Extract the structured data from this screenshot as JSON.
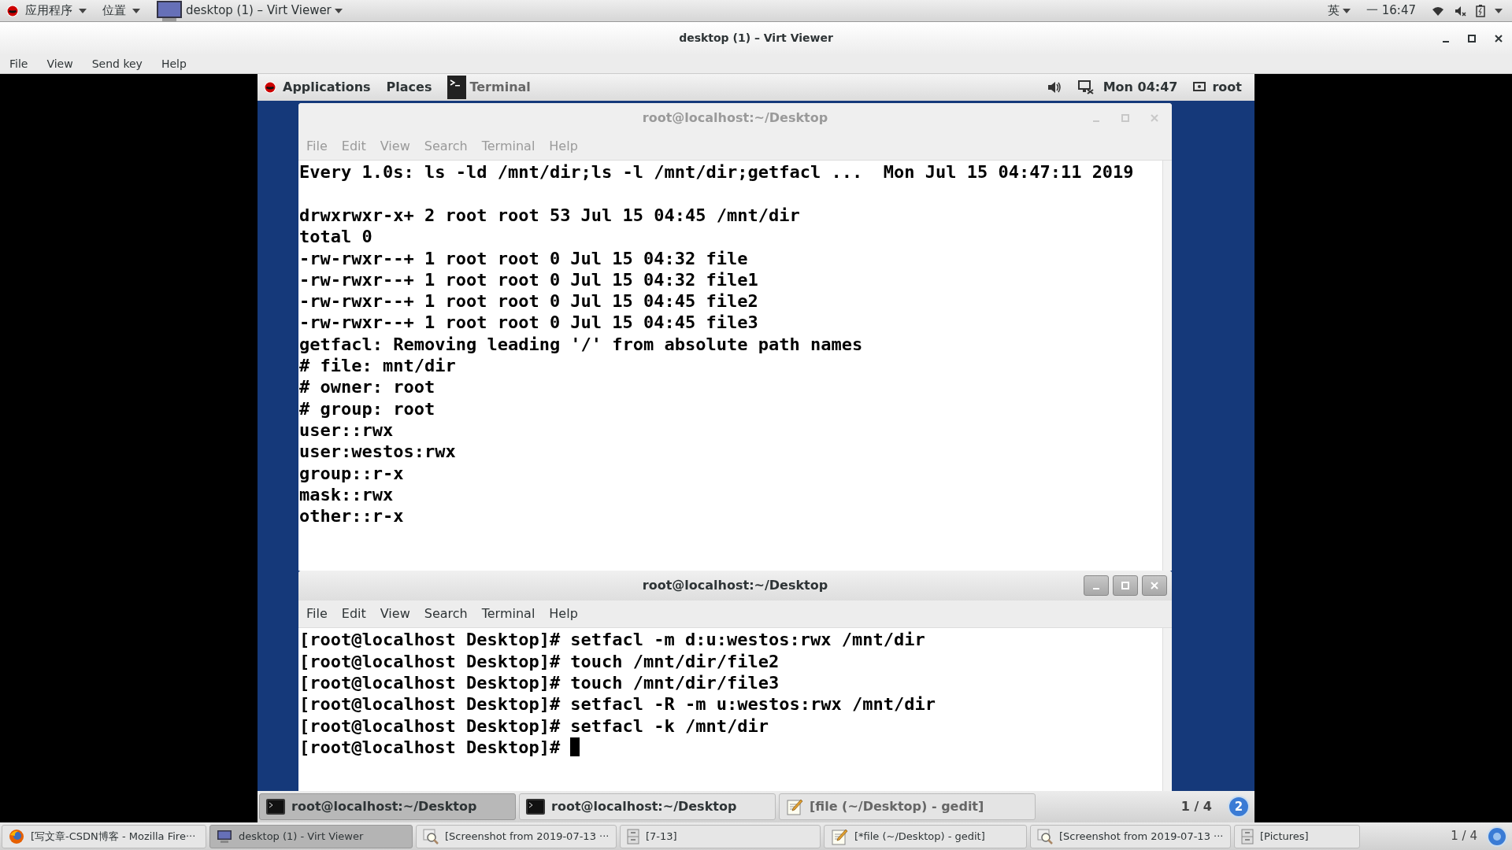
{
  "host_top_bar": {
    "app_menu": "应用程序",
    "places": "位置",
    "window_menu": "desktop (1) – Virt Viewer",
    "input_method": "英",
    "clock": "一 16:47"
  },
  "viewer_window": {
    "title": "desktop (1) – Virt Viewer",
    "menu": [
      "File",
      "View",
      "Send key",
      "Help"
    ]
  },
  "guest_top_bar": {
    "applications": "Applications",
    "places": "Places",
    "active_app": "Terminal",
    "clock": "Mon 04:47",
    "user": "root"
  },
  "terminals": [
    {
      "title": "root@localhost:~/Desktop",
      "focused": false,
      "menu": [
        "File",
        "Edit",
        "View",
        "Search",
        "Terminal",
        "Help"
      ],
      "header": "Every 1.0s: ls -ld /mnt/dir;ls -l /mnt/dir;getfacl ...  Mon Jul 15 04:47:11 2019",
      "lines": [
        "drwxrwxr-x+ 2 root root 53 Jul 15 04:45 /mnt/dir",
        "total 0",
        "-rw-rwxr--+ 1 root root 0 Jul 15 04:32 file",
        "-rw-rwxr--+ 1 root root 0 Jul 15 04:32 file1",
        "-rw-rwxr--+ 1 root root 0 Jul 15 04:45 file2",
        "-rw-rwxr--+ 1 root root 0 Jul 15 04:45 file3",
        "getfacl: Removing leading '/' from absolute path names",
        "# file: mnt/dir",
        "# owner: root",
        "# group: root",
        "user::rwx",
        "user:westos:rwx",
        "group::r-x",
        "mask::rwx",
        "other::r-x"
      ],
      "cursor": false
    },
    {
      "title": "root@localhost:~/Desktop",
      "focused": true,
      "menu": [
        "File",
        "Edit",
        "View",
        "Search",
        "Terminal",
        "Help"
      ],
      "lines": [
        "[root@localhost Desktop]# setfacl -m d:u:westos:rwx /mnt/dir",
        "[root@localhost Desktop]# touch /mnt/dir/file2",
        "[root@localhost Desktop]# touch /mnt/dir/file3",
        "[root@localhost Desktop]# setfacl -R -m u:westos:rwx /mnt/dir",
        "[root@localhost Desktop]# setfacl -k /mnt/dir",
        "[root@localhost Desktop]# "
      ],
      "cursor": true
    }
  ],
  "guest_taskbar": {
    "items": [
      {
        "kind": "terminal",
        "label": "root@localhost:~/Desktop",
        "selected": true
      },
      {
        "kind": "terminal",
        "label": "root@localhost:~/Desktop",
        "selected": false
      },
      {
        "kind": "gedit",
        "label": "[file (~/Desktop) - gedit]",
        "selected": false
      }
    ],
    "workspace": "1 / 4",
    "workspace_badge": "2"
  },
  "host_taskbar": {
    "items": [
      {
        "kind": "firefox",
        "label": "[写文章-CSDN博客 - Mozilla Fire···",
        "selected": false
      },
      {
        "kind": "viewer",
        "label": "desktop (1) - Virt Viewer",
        "selected": true
      },
      {
        "kind": "screenshot",
        "label": "[Screenshot from 2019-07-13 ···",
        "selected": false
      },
      {
        "kind": "files",
        "label": "[7-13]",
        "selected": false
      },
      {
        "kind": "gedit",
        "label": "[*file (~/Desktop) - gedit]",
        "selected": false
      },
      {
        "kind": "screenshot",
        "label": "[Screenshot from 2019-07-13 ···",
        "selected": false
      },
      {
        "kind": "files",
        "label": "[Pictures]",
        "selected": false
      }
    ],
    "workspace": "1 / 4"
  }
}
